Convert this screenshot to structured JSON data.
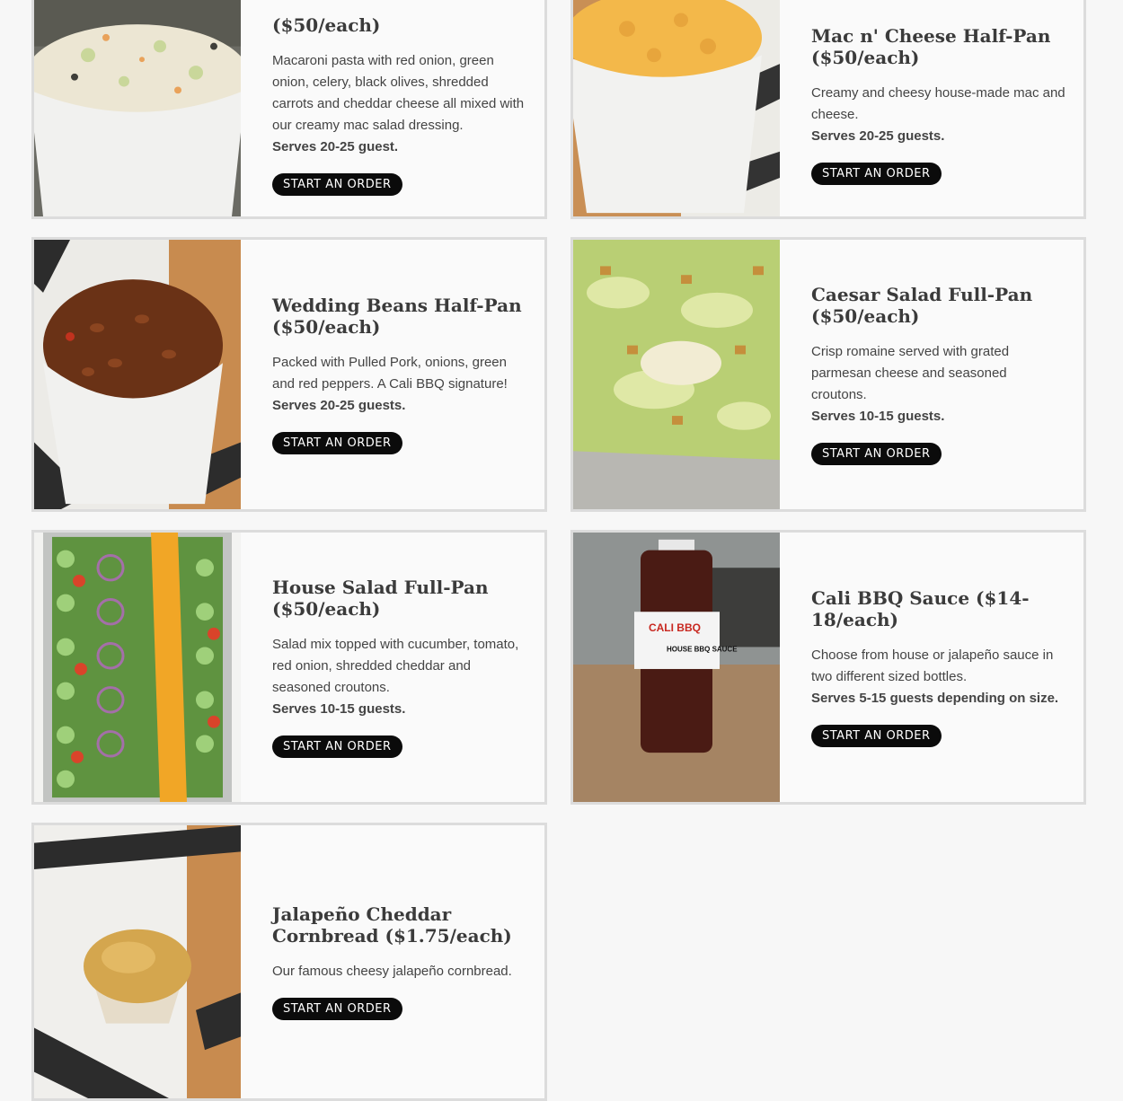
{
  "button_label": "START AN ORDER",
  "items": [
    {
      "title": "($50/each)",
      "description": "Macaroni pasta with red onion, green onion, celery, black olives, shredded carrots and cheddar cheese all mixed with our creamy mac salad dressing.",
      "serves": "Serves 20-25 guest.",
      "image": "macaroni-salad-image"
    },
    {
      "title": "Mac n' Cheese Half-Pan ($50/each)",
      "description": "Creamy and cheesy house-made mac and cheese.",
      "serves": "Serves 20-25 guests.",
      "image": "mac-and-cheese-image"
    },
    {
      "title": "Wedding Beans Half-Pan ($50/each)",
      "description": "Packed with Pulled Pork, onions, green and red peppers. A Cali BBQ signature!",
      "serves": "Serves 20-25 guests.",
      "image": "wedding-beans-image"
    },
    {
      "title": "Caesar Salad Full-Pan ($50/each)",
      "description": "Crisp romaine served with grated parmesan cheese and seasoned croutons.",
      "serves": "Serves 10-15 guests.",
      "image": "caesar-salad-image"
    },
    {
      "title": "House Salad Full-Pan ($50/each)",
      "description": "Salad mix topped with cucumber, tomato, red onion, shredded cheddar and seasoned croutons.",
      "serves": "Serves 10-15 guests.",
      "image": "house-salad-image"
    },
    {
      "title": "Cali BBQ Sauce ($14-18/each)",
      "description": "Choose from house or jalapeño sauce in two different sized bottles.",
      "serves": "Serves 5-15 guests depending on size.",
      "image": "bbq-sauce-bottle-image",
      "bottle_label_top": "CALI BBQ",
      "bottle_label_side": "HOUSE BBQ SAUCE"
    },
    {
      "title": "Jalapeño Cheddar Cornbread ($1.75/each)",
      "description": "Our famous cheesy jalapeño cornbread.",
      "serves": "",
      "image": "cornbread-muffin-image"
    }
  ]
}
